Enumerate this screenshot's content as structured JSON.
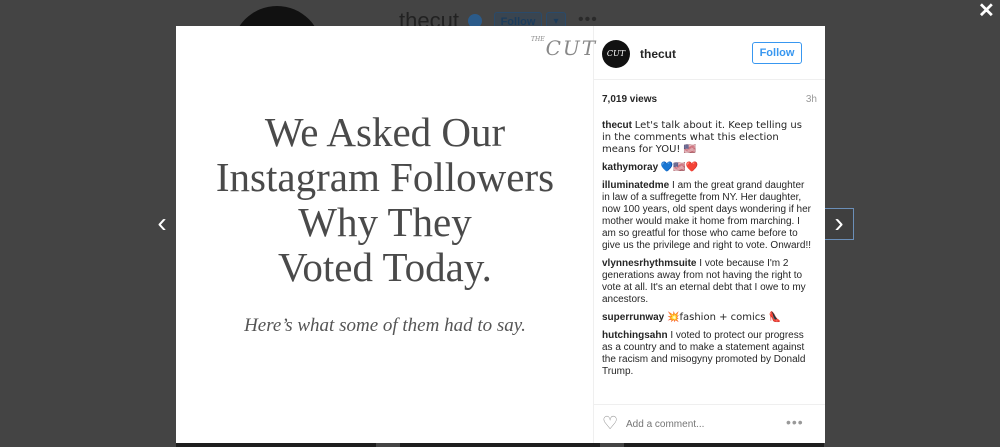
{
  "background": {
    "username": "thecut",
    "follow_label": "Follow",
    "dropdown_icon": "▾",
    "more_icon": "•••"
  },
  "close_icon": "✕",
  "nav": {
    "prev_icon": "‹",
    "next_icon": "›"
  },
  "post": {
    "logo_text": "CUT",
    "logo_prefix": "THE",
    "headline_lines": [
      "We Asked Our",
      "Instagram Followers",
      "Why They",
      "Voted Today."
    ],
    "subline": "Here’s what some of them had to say."
  },
  "header": {
    "avatar_text": "CUT",
    "username": "thecut",
    "follow_label": "Follow"
  },
  "meta": {
    "views": "7,019 views",
    "time": "3h"
  },
  "comments": [
    {
      "author": "thecut",
      "text": "Let's talk about it. Keep telling us in the comments what this election means for YOU! 🇺🇸"
    },
    {
      "author": "kathymoray",
      "text": "💙🇺🇸❤️"
    },
    {
      "author": "illuminatedme",
      "text": "I am the great grand daughter in law of a suffregette from NY. Her daughter, now 100 years, old spent days wondering if her mother would make it home from marching. I am so greatful for those who came before to give us the privilege and right to vote. Onward!!"
    },
    {
      "author": "vlynnesrhythmsuite",
      "text": "I vote because I'm 2 generations away from not having the right to vote at all. It's an eternal debt that I owe to my ancestors."
    },
    {
      "author": "superrunway",
      "text": "💥fashion + comics 👠"
    },
    {
      "author": "hutchingsahn",
      "text": "I voted to protect our progress as a country and to make a statement against the racism and misogyny promoted by Donald Trump."
    }
  ],
  "footer": {
    "heart_icon": "♡",
    "comment_placeholder": "Add a comment...",
    "more_icon": "•••"
  }
}
